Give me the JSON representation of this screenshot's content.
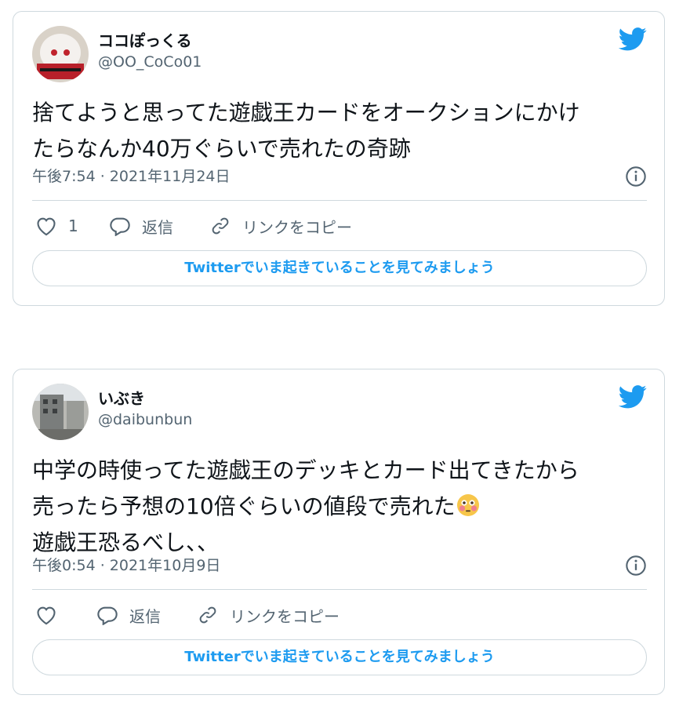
{
  "tweets": [
    {
      "display_name": "ココぽっくる",
      "handle": "@OO_CoCo01",
      "text_lines": [
        "捨てようと思ってた遊戯王カードをオークションにかけ",
        "たらなんか40万ぐらいで売れたの奇跡"
      ],
      "timestamp": "午後7:54 · 2021年11月24日",
      "like_count": "1",
      "reply_label": "返信",
      "copy_link_label": "リンクをコピー",
      "cta_label": "Twitterでいま起きていることを見てみましょう",
      "icons": [
        "twitter-bird-icon",
        "info-icon",
        "heart-icon",
        "reply-icon",
        "link-icon"
      ]
    },
    {
      "display_name": "いぶき",
      "handle": "@daibunbun",
      "text_lines": [
        "中学の時使ってた遊戯王のデッキとカード出てきたから",
        "売ったら予想の10倍ぐらいの値段で売れた",
        "遊戯王恐るべし、、"
      ],
      "emoji": "flushed-face",
      "timestamp": "午後0:54 · 2021年10月9日",
      "like_count": "",
      "reply_label": "返信",
      "copy_link_label": "リンクをコピー",
      "cta_label": "Twitterでいま起きていることを見てみましょう",
      "icons": [
        "twitter-bird-icon",
        "info-icon",
        "heart-icon",
        "reply-icon",
        "link-icon"
      ]
    }
  ],
  "colors": {
    "twitter_blue": "#1d9bf0",
    "text_primary": "#0f1419",
    "text_secondary": "#536471",
    "border": "#cfd9de"
  }
}
